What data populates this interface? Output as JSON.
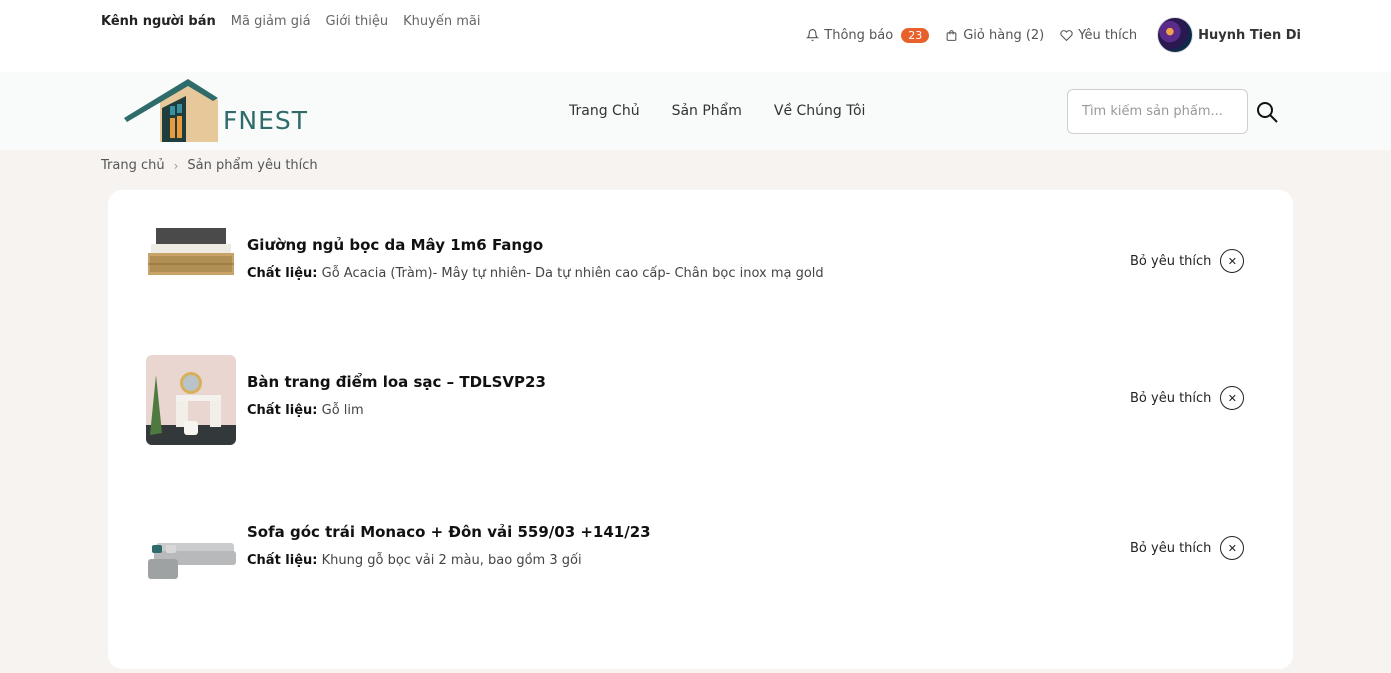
{
  "topbar": {
    "links": [
      "Kênh người bán",
      "Mã giảm giá",
      "Giới thiệu",
      "Khuyến mãi"
    ],
    "notifications": {
      "label": "Thông báo",
      "count": "23"
    },
    "cart": {
      "label": "Giỏ hàng (2)"
    },
    "wishlist": {
      "label": "Yêu thích"
    },
    "user": {
      "name": "Huynh Tien Di"
    }
  },
  "navbar": {
    "logo_text": "FNEST",
    "menu": [
      "Trang Chủ",
      "Sản Phẩm",
      "Về Chúng Tôi"
    ],
    "search_placeholder": "Tìm kiếm sản phẩm..."
  },
  "breadcrumb": {
    "home": "Trang chủ",
    "current": "Sản phẩm yêu thích"
  },
  "favorites": {
    "material_label": "Chất liệu:",
    "remove_label": "Bỏ yêu thích",
    "items": [
      {
        "name": "Giường ngủ bọc da Mây 1m6 Fango",
        "material": "Gỗ Acacia (Tràm)- Mây tự nhiên- Da tự nhiên cao cấp- Chân bọc inox mạ gold"
      },
      {
        "name": "Bàn trang điểm loa sạc – TDLSVP23",
        "material": "Gỗ lim"
      },
      {
        "name": "Sofa góc trái Monaco + Đôn vải 559/03 +141/23",
        "material": "Khung gỗ bọc vải 2 màu, bao gồm 3 gối"
      }
    ]
  },
  "colors": {
    "accent": "#e8612c",
    "brand_teal": "#2e6b6a",
    "brand_beige": "#e6c89a"
  }
}
